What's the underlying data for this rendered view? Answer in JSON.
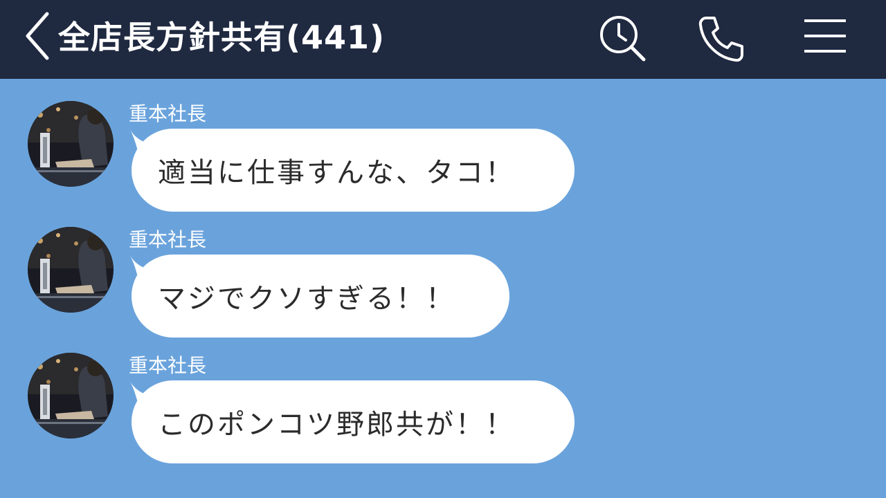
{
  "header": {
    "title": "全店長方針共有(441)",
    "icons": [
      "chevron-left-icon",
      "search-icon",
      "phone-icon",
      "menu-icon"
    ]
  },
  "messages": [
    {
      "sender": "重本社長",
      "text": "適当に仕事すんな、タコ！"
    },
    {
      "sender": "重本社長",
      "text": "マジでクソすぎる！！"
    },
    {
      "sender": "重本社長",
      "text": "このポンコツ野郎共が！！"
    }
  ],
  "colors": {
    "header_bg": "#1f2940",
    "chat_bg": "#6aa3dc",
    "bubble_bg": "#ffffff",
    "text": "#2b2b2b"
  }
}
